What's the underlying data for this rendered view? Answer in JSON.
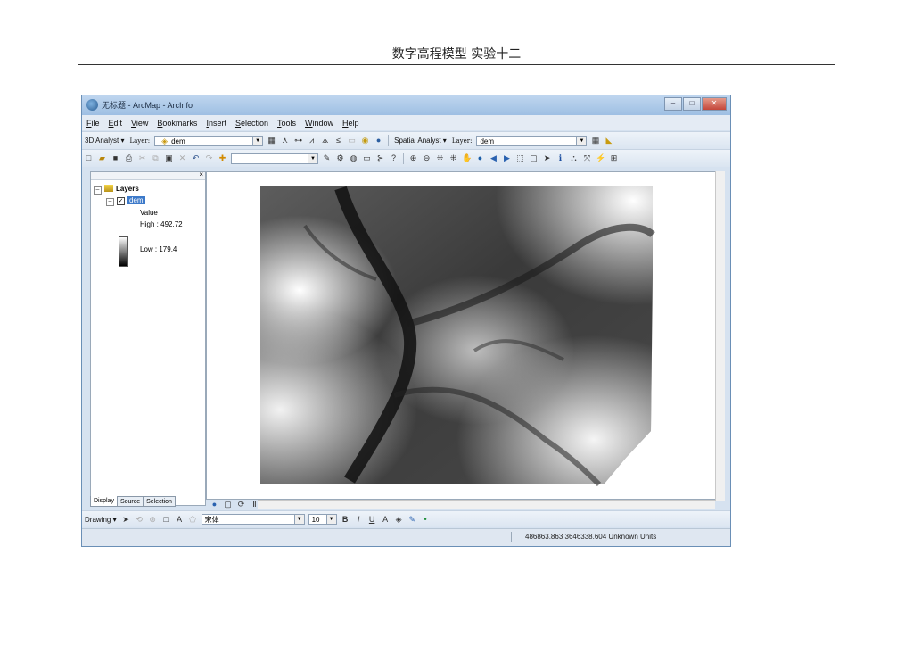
{
  "document": {
    "header": "数字高程模型  实验十二"
  },
  "window": {
    "title": "无标题 - ArcMap - ArcInfo",
    "controls": [
      "–",
      "□",
      "✕"
    ]
  },
  "menubar": [
    "File",
    "Edit",
    "View",
    "Bookmarks",
    "Insert",
    "Selection",
    "Tools",
    "Window",
    "Help"
  ],
  "toolbar_3d": {
    "menu_label": "3D Analyst ▾",
    "layer_label": "Layer:",
    "layer_value": "dem"
  },
  "toolbar_spatial": {
    "menu_label": "Spatial Analyst ▾",
    "layer_label": "Layer:",
    "layer_value": "dem"
  },
  "toc": {
    "root": "Layers",
    "layer": "dem",
    "legend_title": "Value",
    "high_label": "High : 492.72",
    "low_label": "Low : 179.4",
    "tabs": [
      "Display",
      "Source",
      "Selection"
    ]
  },
  "drawing_toolbar": {
    "menu_label": "Drawing ▾",
    "font_name": "宋体",
    "font_size": "10",
    "bold": "B",
    "italic": "I",
    "underline": "U"
  },
  "status": {
    "coords": "486863.863  3646338.604 Unknown Units"
  },
  "colors": {
    "title_bar": "#9ebfe3",
    "selection": "#3c79c9",
    "dem_high": "#ffffff",
    "dem_low": "#000000"
  },
  "icons": {
    "new": "new-document-icon",
    "open": "open-folder-icon",
    "save": "save-icon",
    "print": "print-icon",
    "zoom_in": "zoom-in-icon",
    "zoom_out": "zoom-out-icon",
    "pan": "pan-hand-icon",
    "full_extent": "globe-icon",
    "identify": "identify-icon",
    "find": "binoculars-icon",
    "select": "arrow-pointer-icon"
  }
}
